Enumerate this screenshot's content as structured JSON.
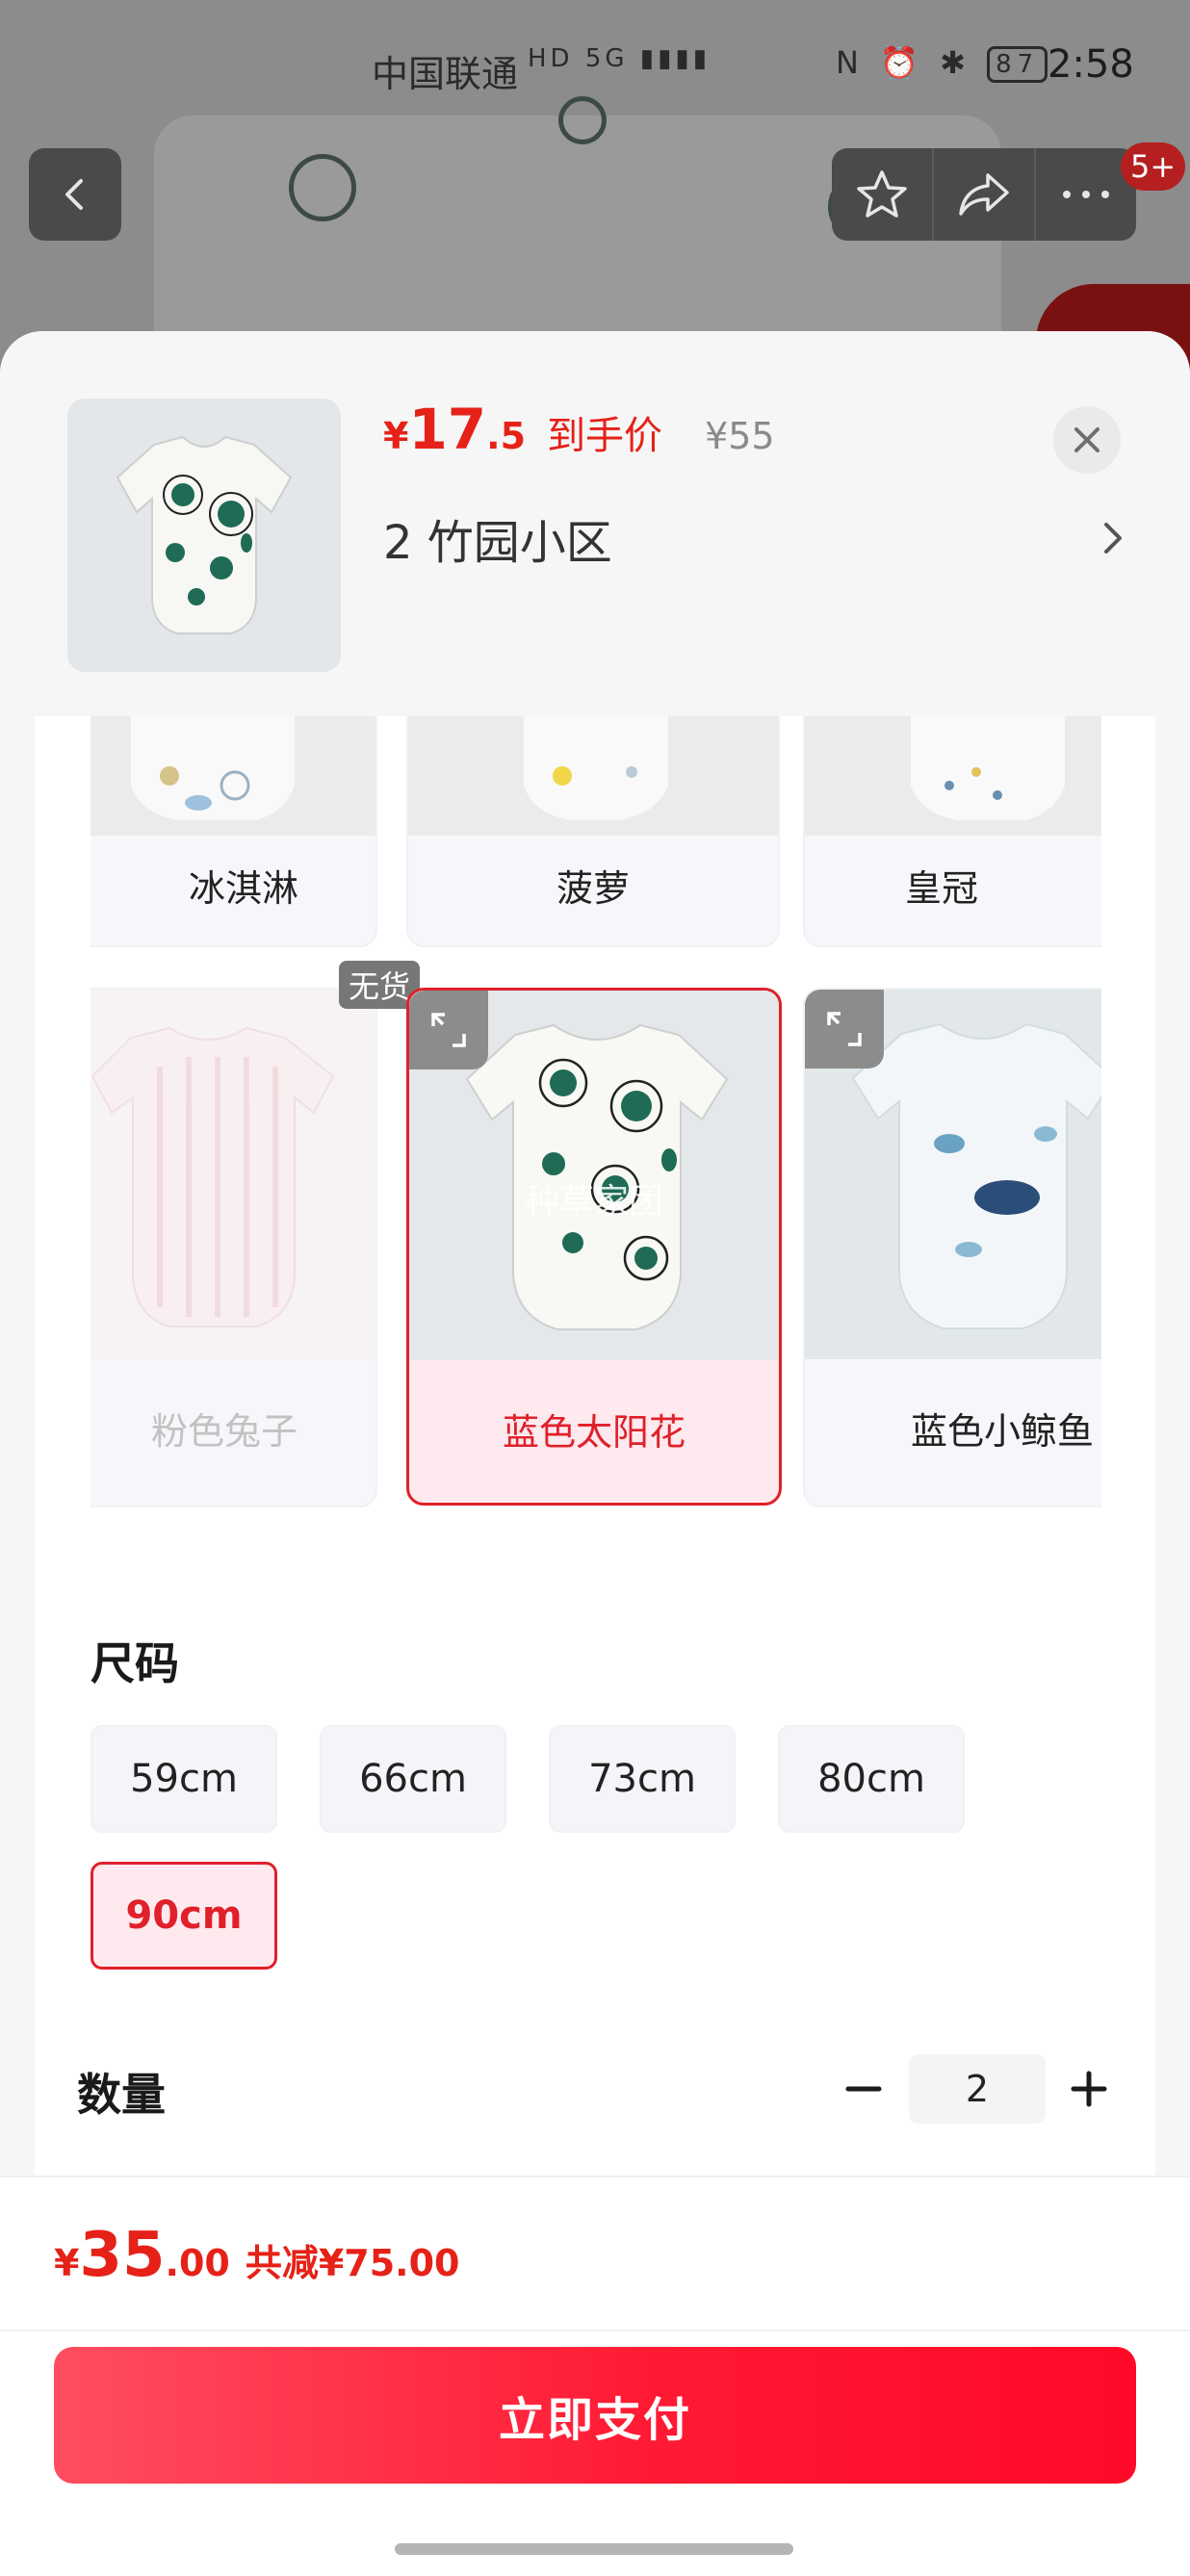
{
  "status_bar": {
    "carrier": "中国联通",
    "network_icons": "HD 5G ▮▮▮▮",
    "right_icons": "N ⏰ ✱",
    "battery": "87",
    "time": "2:58"
  },
  "nav": {
    "badge": "5+"
  },
  "sheet": {
    "price": {
      "currency": "¥",
      "integer": "17",
      "decimal": ".5",
      "label": "到手价",
      "original": "¥55"
    },
    "address": "2  竹园小区"
  },
  "variants": [
    {
      "label": "冰淇淋",
      "state": "normal"
    },
    {
      "label": "菠萝",
      "state": "normal"
    },
    {
      "label": "皇冠",
      "state": "normal"
    },
    {
      "label": "粉色兔子",
      "state": "out_of_stock",
      "badge": "无货"
    },
    {
      "label": "蓝色太阳花",
      "state": "selected",
      "watermark": "种草家团"
    },
    {
      "label": "蓝色小鲸鱼",
      "state": "normal"
    }
  ],
  "size": {
    "title": "尺码",
    "options": [
      "59cm",
      "66cm",
      "73cm",
      "80cm",
      "90cm"
    ],
    "selected": "90cm"
  },
  "quantity": {
    "title": "数量",
    "minus": "−",
    "value": "2",
    "plus": "+"
  },
  "footer": {
    "currency": "¥",
    "total_integer": "35",
    "total_decimal": ".00",
    "saving": "共减¥75.00",
    "pay_button": "立即支付"
  },
  "colors": {
    "accent": "#e62117",
    "selected_bg": "#fde9ee",
    "pay_gradient_start": "#ff4d60",
    "pay_gradient_end": "#ff0a28"
  },
  "icons": [
    "back-icon",
    "star-icon",
    "share-icon",
    "more-icon",
    "close-icon",
    "chevron-right-icon",
    "expand-icon"
  ]
}
